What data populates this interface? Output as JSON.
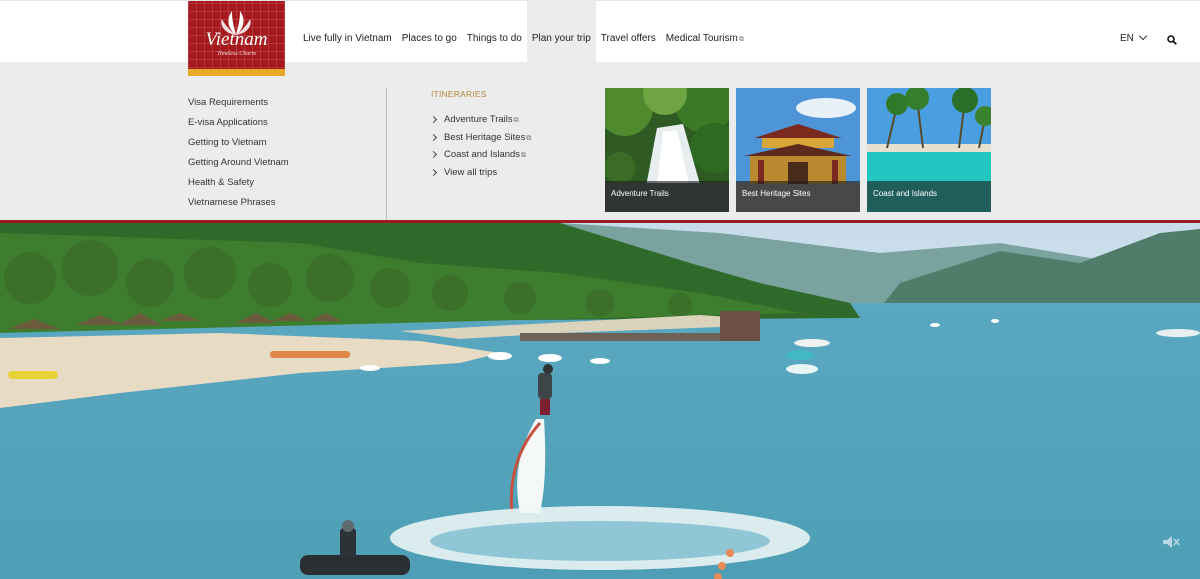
{
  "logo": {
    "brand": "Vietnam",
    "tagline": "Timeless Charm"
  },
  "nav": {
    "items": [
      {
        "label": "Live fully in Vietnam"
      },
      {
        "label": "Places to go"
      },
      {
        "label": "Things to do"
      },
      {
        "label": "Plan your trip",
        "active": true
      },
      {
        "label": "Travel offers"
      },
      {
        "label": "Medical Tourism",
        "external": true
      }
    ],
    "language": "EN",
    "search_icon": "search-icon"
  },
  "mega_menu": {
    "plan_links": [
      "Visa Requirements",
      "E-visa Applications",
      "Getting to Vietnam",
      "Getting Around Vietnam",
      "Health & Safety",
      "Vietnamese Phrases"
    ],
    "itineraries": {
      "heading": "ITINERARIES",
      "items": [
        {
          "label": "Adventure Trails",
          "external": true
        },
        {
          "label": "Best Heritage Sites",
          "external": true
        },
        {
          "label": "Coast and Islands",
          "external": true
        },
        {
          "label": "View all trips",
          "external": false
        }
      ]
    },
    "cards": [
      {
        "caption": "Adventure Trails"
      },
      {
        "caption": "Best Heritage Sites"
      },
      {
        "caption": "Coast and Islands"
      }
    ]
  },
  "colors": {
    "brand_red": "#a5191c",
    "accent_gold": "#b3863a",
    "menu_bg": "#ececec",
    "divider_red": "#9b1c1f"
  }
}
